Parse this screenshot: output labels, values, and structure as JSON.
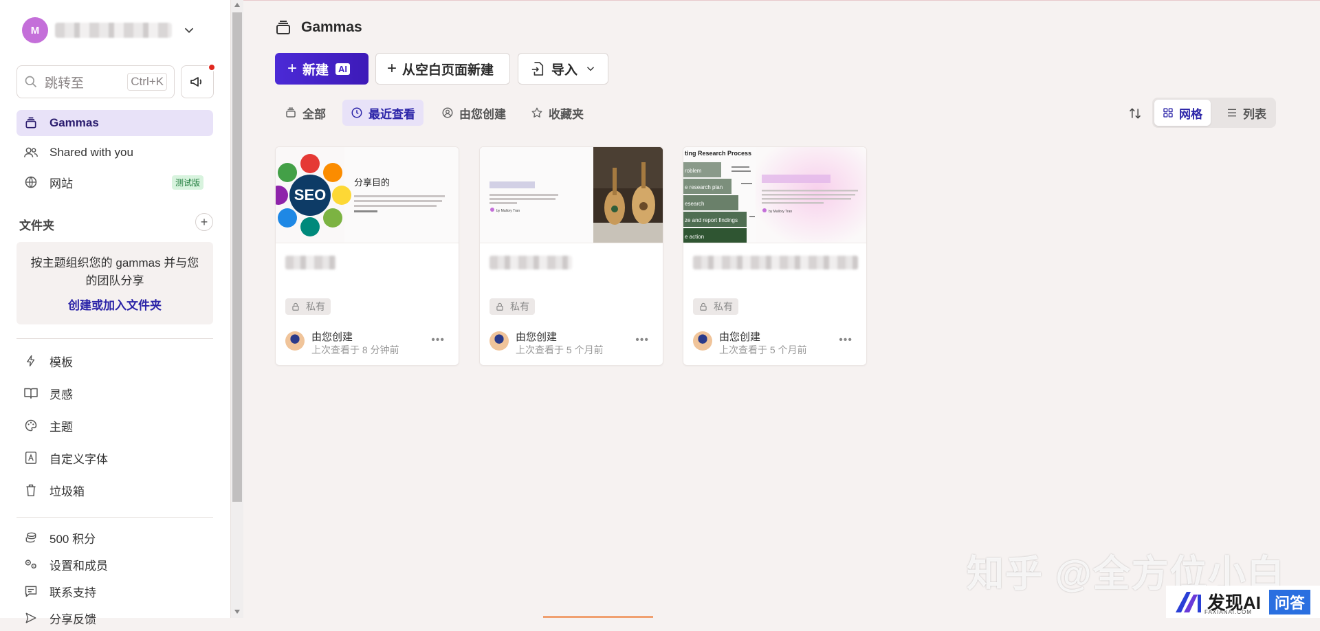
{
  "sidebar": {
    "user_initial": "M",
    "search_placeholder": "跳转至",
    "search_shortcut": "Ctrl+K",
    "nav": [
      {
        "label": "Gammas",
        "icon": "stack-icon",
        "active": true
      },
      {
        "label": "Shared with you",
        "icon": "users-icon"
      },
      {
        "label": "网站",
        "icon": "globe-icon",
        "badge": "测试版"
      }
    ],
    "folders": {
      "heading": "文件夹",
      "empty_text": "按主题组织您的 gammas 并与您的团队分享",
      "link": "创建或加入文件夹"
    },
    "tools": [
      {
        "label": "模板",
        "icon": "bolt-icon"
      },
      {
        "label": "灵感",
        "icon": "book-icon"
      },
      {
        "label": "主题",
        "icon": "palette-icon"
      },
      {
        "label": "自定义字体",
        "icon": "font-icon"
      },
      {
        "label": "垃圾箱",
        "icon": "trash-icon"
      }
    ],
    "account": [
      {
        "label": "500 积分",
        "icon": "coins-icon"
      },
      {
        "label": "设置和成员",
        "icon": "settings-icon"
      },
      {
        "label": "联系支持",
        "icon": "chat-icon"
      },
      {
        "label": "分享反馈",
        "icon": "send-icon"
      }
    ]
  },
  "main": {
    "title": "Gammas",
    "buttons": {
      "new": "新建",
      "new_badge": "AI",
      "blank": "从空白页面新建",
      "import": "导入"
    },
    "tabs": [
      {
        "label": "全部",
        "icon": "stack-icon"
      },
      {
        "label": "最近查看",
        "icon": "clock-icon",
        "active": true
      },
      {
        "label": "由您创建",
        "icon": "user-circle-icon"
      },
      {
        "label": "收藏夹",
        "icon": "star-icon"
      }
    ],
    "view": {
      "grid": "网格",
      "list": "列表"
    },
    "cards": [
      {
        "privacy": "私有",
        "owner": "由您创建",
        "viewed": "上次查看于 8 分钟前",
        "thumb": {
          "heading": "分享目的",
          "seo": "SEO"
        }
      },
      {
        "privacy": "私有",
        "owner": "由您创建",
        "viewed": "上次查看于 5 个月前",
        "thumb": {
          "byline": "by Mallory Tran"
        }
      },
      {
        "privacy": "私有",
        "owner": "由您创建",
        "viewed": "上次查看于 5 个月前",
        "thumb": {
          "header": "ting Research Process",
          "steps": [
            "roblem",
            "e research plan",
            "esearch",
            "ze and report findings",
            "e action"
          ],
          "byline": "by Mallory Tran"
        }
      }
    ]
  },
  "overlay": {
    "watermark": "知乎 @全方位小白",
    "brand": "发现AI",
    "brand_sub": "FAXIANAI.COM",
    "brand_ask": "问答"
  },
  "colors": {
    "accent": "#4b2ad6",
    "active_bg": "#e8e2f8",
    "link": "#2b24a8"
  }
}
